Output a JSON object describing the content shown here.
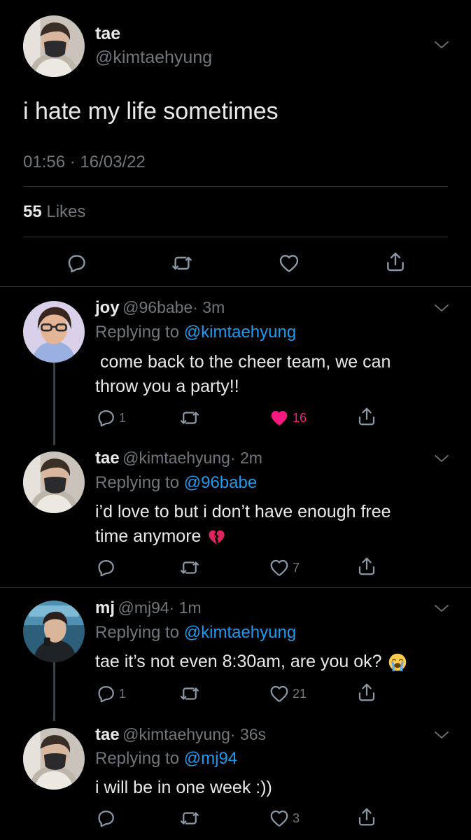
{
  "main_tweet": {
    "name": "tae",
    "handle": "@kimtaehyung",
    "text": "i hate my life sometimes",
    "timestamp": "01:56 · 16/03/22",
    "likes_count": "55",
    "likes_label": "Likes"
  },
  "replies": [
    {
      "name": "joy",
      "handle": "@96babe",
      "time": "· 3m",
      "replying_label": "Replying to",
      "replying_to": "@kimtaehyung",
      "text_line1": " come back to the cheer team, we can",
      "text_line2": "throw you a party!!",
      "reply_count": "1",
      "like_count": "16",
      "liked": true
    },
    {
      "name": "tae",
      "handle": "@kimtaehyung",
      "time": "· 2m",
      "replying_label": "Replying to",
      "replying_to": "@96babe",
      "text_line1": "i’d love to but i don’t have enough free",
      "text_line2": "time anymore",
      "emoji": "broken-heart-emoji",
      "reply_count": "",
      "like_count": "7"
    },
    {
      "name": "mj",
      "handle": "@mj94",
      "time": "· 1m",
      "replying_label": "Replying to",
      "replying_to": "@kimtaehyung",
      "text_line1": "tae it’s not even 8:30am, are you ok?",
      "emoji": "loudly-crying-face-emoji",
      "reply_count": "1",
      "like_count": "21"
    },
    {
      "name": "tae",
      "handle": "@kimtaehyung",
      "time": "· 36s",
      "replying_label": "Replying to",
      "replying_to": "@mj94",
      "text_line1": "i will be in one week :))",
      "reply_count": "",
      "like_count": "3"
    }
  ],
  "colors": {
    "background": "#000000",
    "text": "#e7e9ea",
    "secondary": "#71767b",
    "link": "#1d9bf0",
    "like": "#f91880",
    "divider": "#2f3336"
  }
}
